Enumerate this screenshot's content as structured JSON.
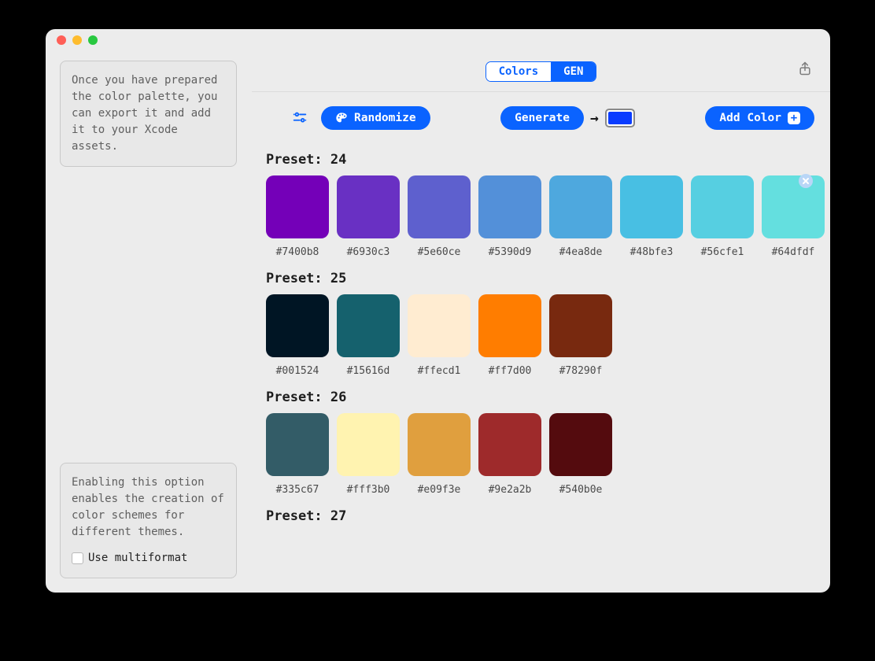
{
  "sidebar": {
    "top_info": "Once you have prepared the color palette, you can export it and add it to your Xcode assets.",
    "bottom_info": "Enabling this option enables the creation of color schemes for different themes.",
    "multiformat_label": "Use multiformat",
    "multiformat_checked": false
  },
  "tabs": {
    "colors": "Colors",
    "gen": "GEN",
    "active": "gen"
  },
  "toolbar": {
    "randomize": "Randomize",
    "generate": "Generate",
    "add_color": "Add Color",
    "well_color": "#0a3cff"
  },
  "presets": [
    {
      "title": "Preset: 24",
      "colors": [
        "#7400b8",
        "#6930c3",
        "#5e60ce",
        "#5390d9",
        "#4ea8de",
        "#48bfe3",
        "#56cfe1",
        "#64dfdf"
      ]
    },
    {
      "title": "Preset: 25",
      "colors": [
        "#001524",
        "#15616d",
        "#ffecd1",
        "#ff7d00",
        "#78290f"
      ]
    },
    {
      "title": "Preset: 26",
      "colors": [
        "#335c67",
        "#fff3b0",
        "#e09f3e",
        "#9e2a2b",
        "#540b0e"
      ]
    },
    {
      "title": "Preset: 27",
      "colors": []
    }
  ]
}
